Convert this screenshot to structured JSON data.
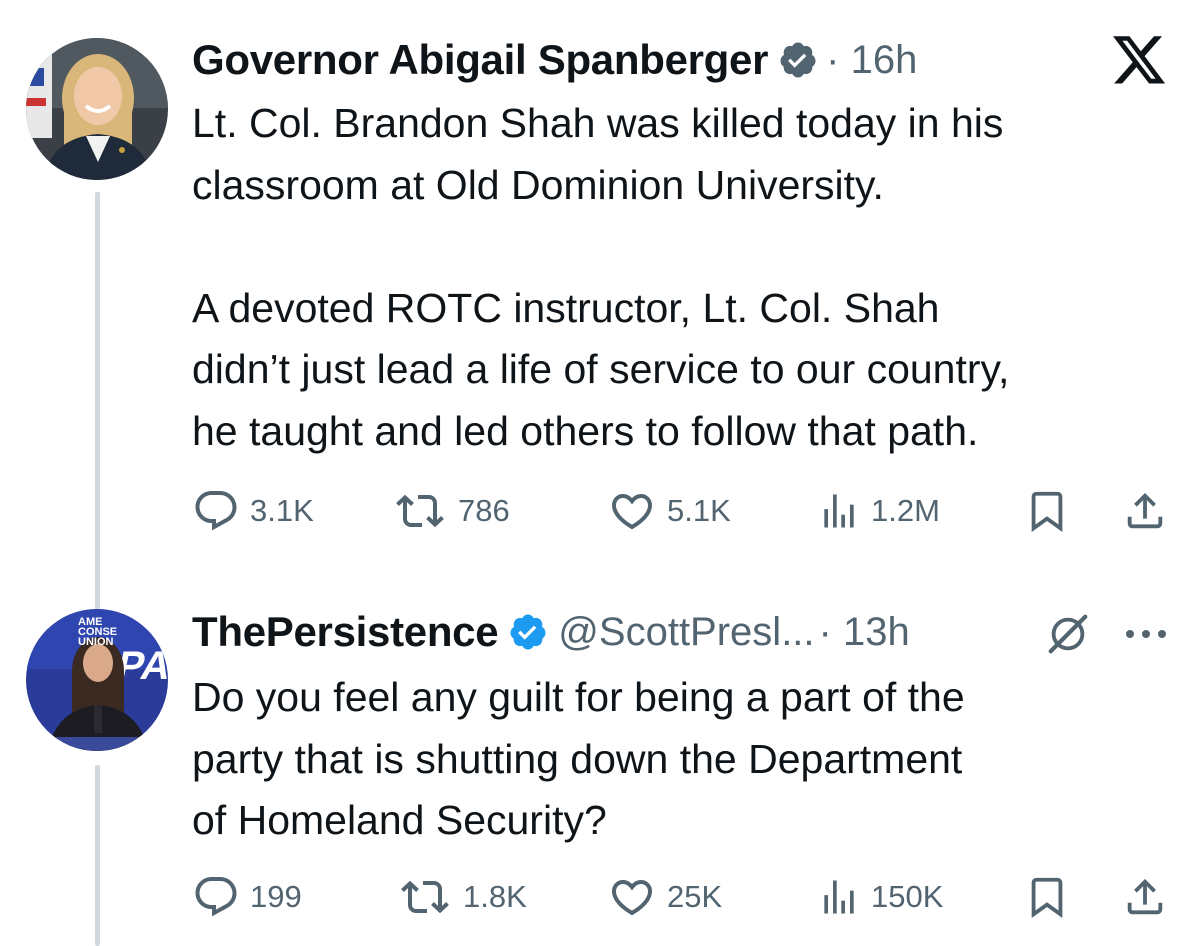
{
  "tweets": [
    {
      "display_name": "Governor Abigail Spanberger",
      "verified": true,
      "verified_color": "#536471",
      "time": "· 16h",
      "platform_icon": "x-logo-icon",
      "text": "Lt. Col. Brandon Shah was killed today in his\nclassroom at Old Dominion University.\n\nA devoted ROTC instructor, Lt. Col. Shah\ndidn’t just lead a life of service to our country,\nhe taught and led others to follow that path.",
      "stats": {
        "replies": "3.1K",
        "reposts": "786",
        "likes": "5.1K",
        "views": "1.2M"
      }
    },
    {
      "display_name": "ThePersistence",
      "verified": true,
      "verified_color": "#1d9bf0",
      "handle": "@ScottPresl...",
      "time": "· 13h",
      "extra_icon": "grok-icon",
      "more_icon": "more-dots-icon",
      "avatar_sign_text": "AME\nCONSE\nUNION",
      "text": "Do you feel any guilt for being a part of the\nparty that is shutting down the Department\nof Homeland Security?",
      "stats": {
        "replies": "199",
        "reposts": "1.8K",
        "likes": "25K",
        "views": "150K"
      }
    }
  ],
  "colors": {
    "text_primary": "#0f1419",
    "text_secondary": "#536471",
    "thread_line": "#cfd9de",
    "verified_blue": "#1d9bf0"
  }
}
